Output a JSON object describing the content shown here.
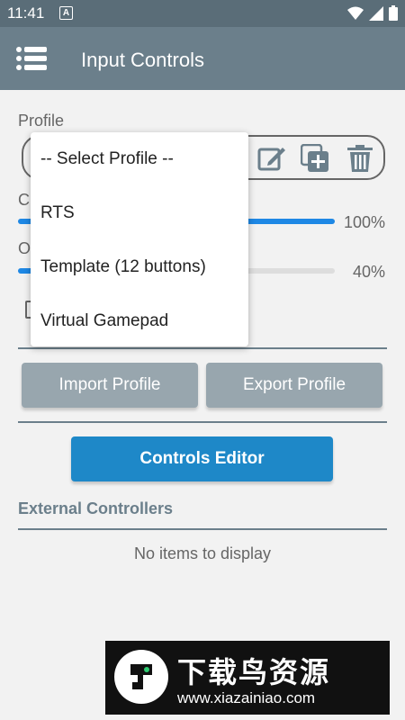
{
  "status": {
    "time": "11:41",
    "notification_glyph": "A"
  },
  "app_bar": {
    "title": "Input Controls"
  },
  "profile": {
    "label": "Profile"
  },
  "sliders": [
    {
      "label_fragment": "C",
      "value": 1.0,
      "value_text": "100%"
    },
    {
      "label_fragment": "O",
      "value": 0.4,
      "value_text": "40%"
    }
  ],
  "buttons": {
    "import": "Import Profile",
    "export": "Export Profile",
    "controls_editor": "Controls Editor"
  },
  "external": {
    "title": "External Controllers",
    "empty": "No items to display"
  },
  "dropdown": {
    "options": [
      "-- Select Profile --",
      "RTS",
      "Template (12 buttons)",
      "Virtual Gamepad"
    ]
  },
  "watermark": {
    "brand": "下载鸟资源",
    "url": "www.xiazainiao.com"
  },
  "colors": {
    "status_bar": "#5a6d78",
    "app_bar": "#6b7f8b",
    "accent_blue": "#1e88e5",
    "button_grey": "#98a6ae",
    "button_blue": "#1e88c8"
  }
}
